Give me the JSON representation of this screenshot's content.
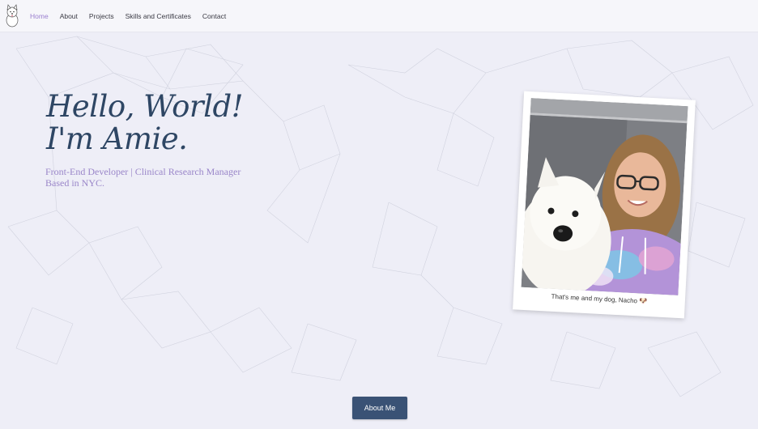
{
  "nav": {
    "logo_icon": "westie-dog-logo",
    "items": [
      {
        "label": "Home",
        "active": true
      },
      {
        "label": "About",
        "active": false
      },
      {
        "label": "Projects",
        "active": false
      },
      {
        "label": "Skills and Certificates",
        "active": false
      },
      {
        "label": "Contact",
        "active": false
      }
    ]
  },
  "hero": {
    "title_line1": "Hello, World!",
    "title_line2": "I'm Amie.",
    "subtitle_line1": "Front-End Developer | Clinical Research Manager",
    "subtitle_line2": "Based in NYC."
  },
  "photo": {
    "caption": "That's me and my dog, Nacho 🐶"
  },
  "cta": {
    "about_label": "About Me"
  },
  "colors": {
    "title": "#2e4664",
    "subtitle": "#9a86c9",
    "active_nav": "#9a7fcf",
    "button": "#3a5275"
  }
}
